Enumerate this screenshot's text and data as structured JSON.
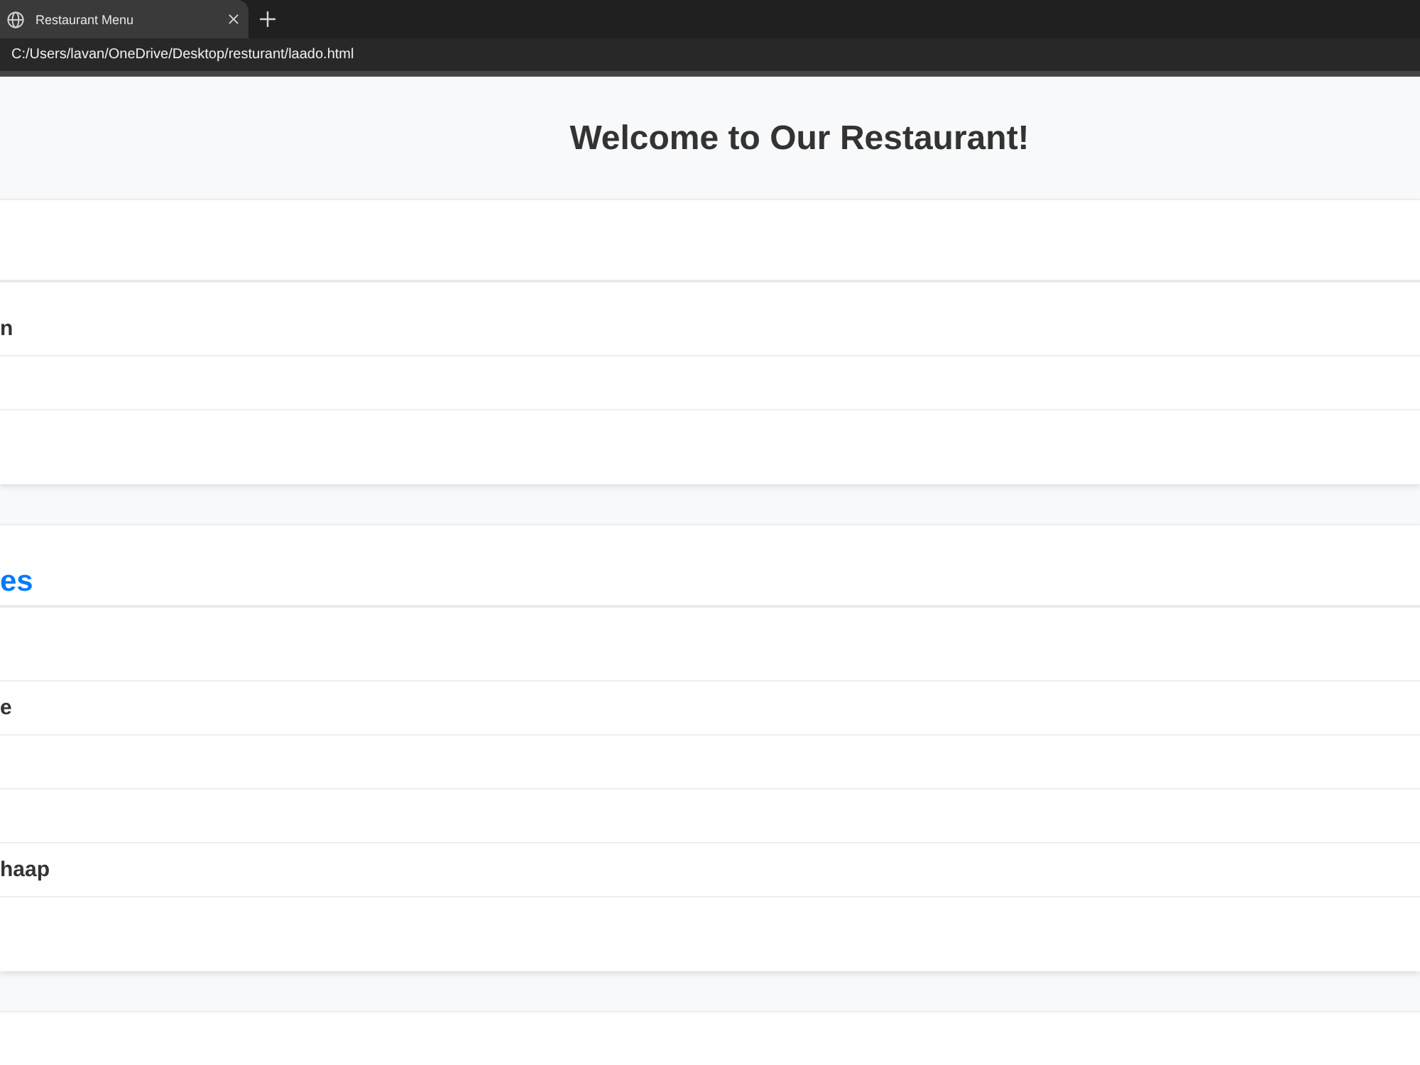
{
  "browser": {
    "tab": {
      "title": "Restaurant Menu",
      "selected": true
    },
    "address": "C:/Users/lavan/OneDrive/Desktop/resturant/laado.html"
  },
  "header": {
    "title": "Welcome to Our Restaurant!"
  },
  "sections": [
    {
      "items": [
        {
          "kind": "item",
          "text": "n"
        },
        {
          "kind": "empty"
        },
        {
          "kind": "empty"
        }
      ]
    },
    {
      "heading": "es",
      "items": [
        {
          "kind": "empty"
        },
        {
          "kind": "item",
          "text": "e"
        },
        {
          "kind": "empty"
        },
        {
          "kind": "empty"
        },
        {
          "kind": "item",
          "text": "haap"
        },
        {
          "kind": "empty"
        }
      ]
    }
  ]
}
